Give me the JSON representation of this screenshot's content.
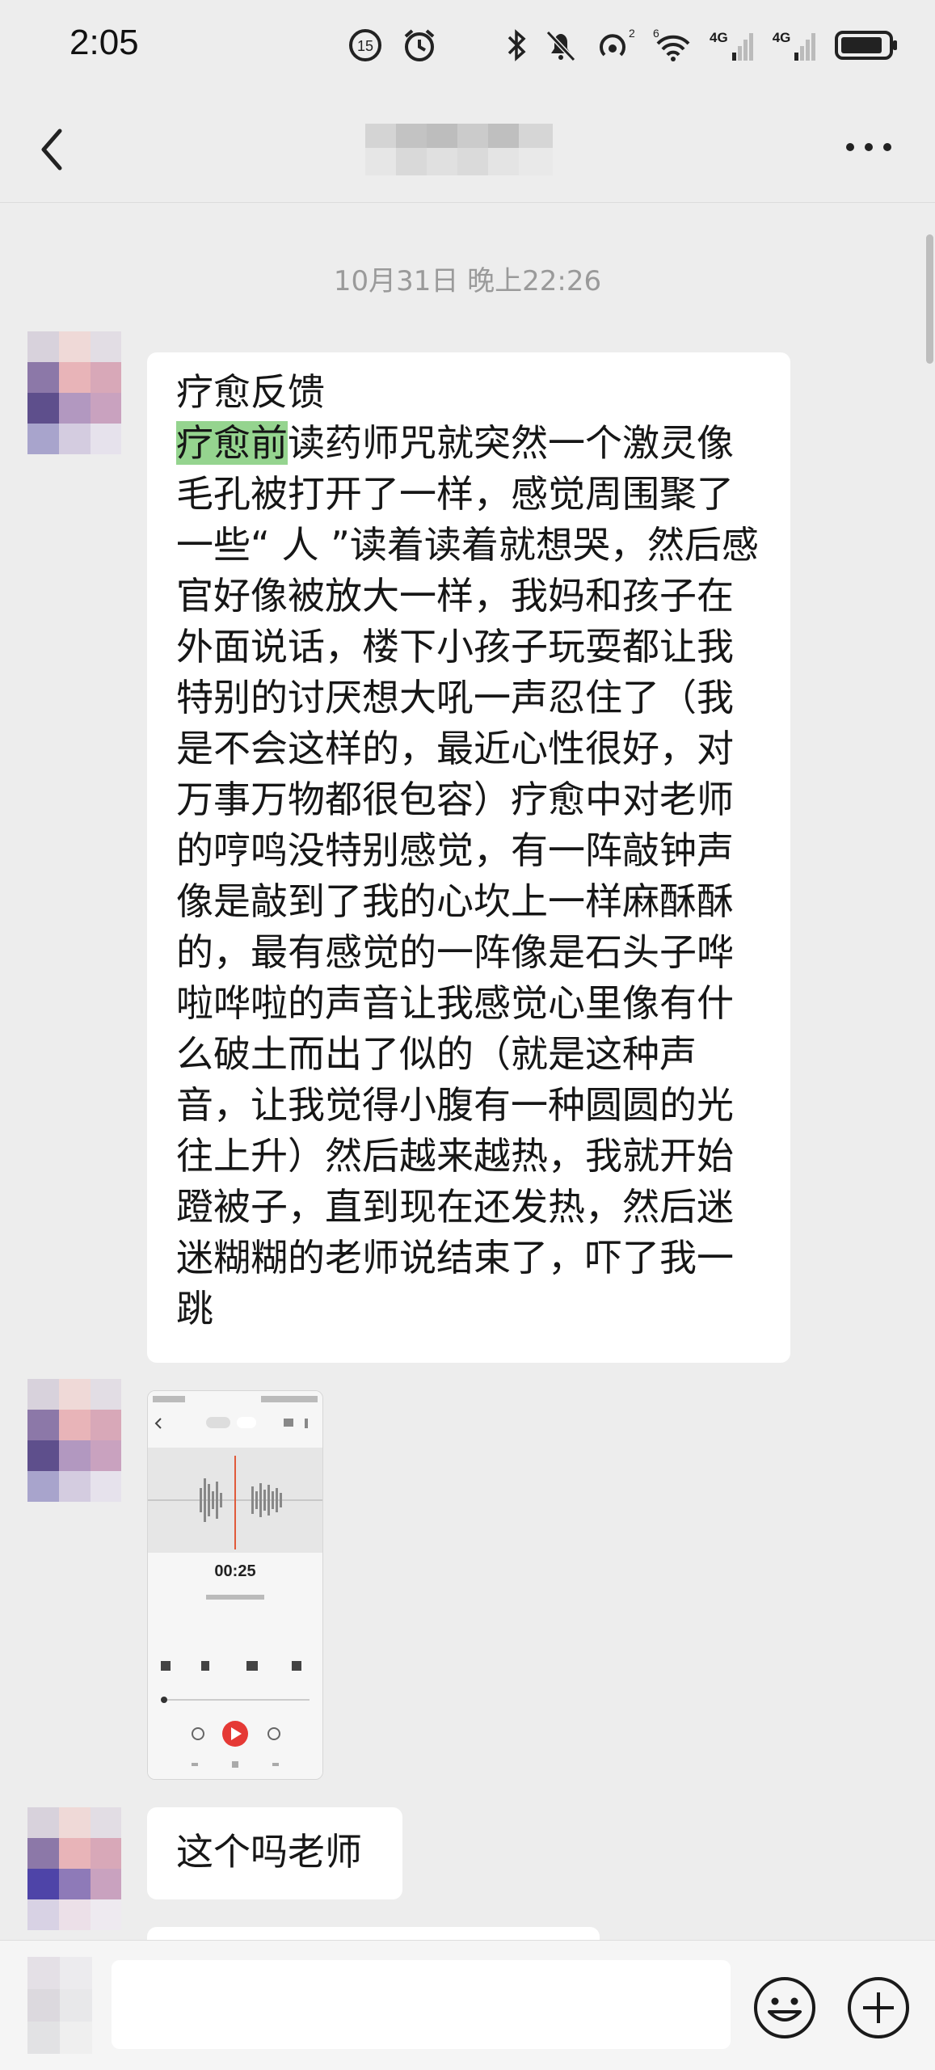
{
  "status_bar": {
    "time": "2:05",
    "network_label_1": "4G",
    "network_label_2": "4G"
  },
  "header": {
    "title_blurred": true
  },
  "messages": {
    "timestamp": "10月31日 晚上22:26",
    "feedback": {
      "line1": "疗愈反馈",
      "highlight": "疗愈前",
      "body": "读药师咒就突然一个激灵像毛孔被打开了一样，感觉周围聚了一些“ 人 ”读着读着就想哭，然后感官好像被放大一样，我妈和孩子在外面说话，楼下小孩子玩耍都让我特别的讨厌想大吼一声忍住了（我是不会这样的，最近心性很好，对万事万物都很包容）疗愈中对老师的哼鸣没特别感觉，有一阵敲钟声像是敲到了我的心坎上一样麻酥酥的，最有感觉的一阵像是石头子哗啦哗啦的声音让我感觉心里像有什么破土而出了似的（就是这种声音，让我觉得小腹有一种圆圆的光往上升）然后越来越热，我就开始蹬被子，直到现在还发热，然后迷迷糊糊的老师说结束了，吓了我一跳"
    },
    "image": {
      "recorder_time": "00:25"
    },
    "question": "这个吗老师"
  },
  "input": {
    "value": "",
    "placeholder": ""
  },
  "colors": {
    "background": "#ededed",
    "bubble": "#ffffff",
    "highlight": "#95d48f",
    "play_button": "#e53935"
  },
  "icons": [
    "back-arrow-icon",
    "more-dots-icon",
    "emoji-icon",
    "plus-icon"
  ]
}
